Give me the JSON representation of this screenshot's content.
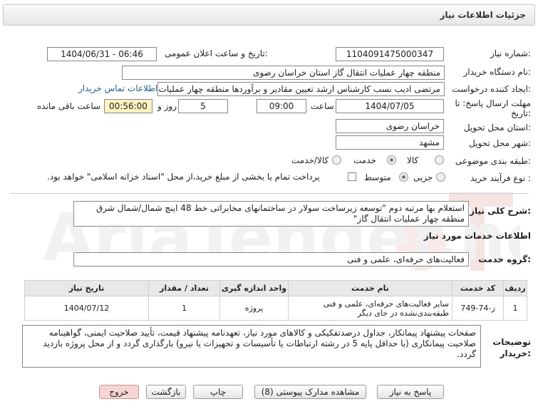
{
  "title": "جزئیات اطلاعات نیاز",
  "labels": {
    "need_number": "شماره نیاز:",
    "announce_datetime": "تاریخ و ساعت اعلان عمومی:",
    "buyer_org": "نام دستگاه خریدار:",
    "requester": "ایجاد کننده درخواست:",
    "deadline_line1": "مهلت ارسال پاسخ: تا",
    "deadline_line2": "تاریخ:",
    "time_word": "ساعت",
    "days_word": "روز و",
    "remaining_word": "ساعت باقی مانده",
    "province": "استان محل تحویل:",
    "city": "شهر محل تحویل:",
    "category": "طبقه بندی موضوعی:",
    "process_type": "نوع فرآیند خرید :",
    "general_desc": "شرح کلی نیاز:",
    "services_info": "اطلاعات خدمات مورد نیاز",
    "service_group": "گروه خدمت:",
    "buyer_notes_1": "توضیحات",
    "buyer_notes_2": "خریدار:"
  },
  "values": {
    "need_number": "1104091475000347",
    "announce_datetime": "1404/06/31 - 06:46",
    "buyer_org": "منطقه چهار عملیات انتقال گاز    استان خراسان رضوی",
    "requester": "مرتضی ادیب نسب کارشناس ارشد تعیین مقادیر و برآوردها منطقه چهار عملیات",
    "contact_link": "اطلاعات تماس خریدار",
    "deadline_date": "1404/07/05",
    "deadline_time": "09:00",
    "days": "5",
    "remaining": "00:56:00",
    "province": "خراسان رضوی",
    "city": "مشهد",
    "category_options": [
      "کالا",
      "خدمت",
      "کالا/خدمت"
    ],
    "category_selected": "خدمت",
    "process_options": [
      "جزیی",
      "متوسط"
    ],
    "process_selected": "متوسط",
    "payment_note": "پرداخت تمام یا بخشی از مبلغ خرید،از محل \"اسناد خزانه اسلامی\" خواهد بود.",
    "general_desc": "استعلام بها مرتبه دوم \"توسعه زیرساخت سولار در ساختمانهای مخابراتی خط 48 اینچ شمال/شمال شرق منطقه چهار عملیات انتقال گاز\"",
    "service_group": "فعالیت‌های حرفه‌ای، علمی و فنی",
    "buyer_notes": "صفحات پیشنهاد پیمانکار، جداول درصدتفکیکی و کالاهای مورد نیاز، تعهدنامه پیشنهاد قیمت، تأیید صلاحیت ایمنی، گواهینامه صلاحیت پیمانکاری (با حداقل پایه 5 در رشته ارتباطات یا تأسیسات و تجهیزات یا نیرو) بارگذاری گردد و از محل پروژه بازدید گردد."
  },
  "table": {
    "headers": [
      "ردیف",
      "کد خدمت",
      "نام خدمت",
      "واحد اندازه گیری",
      "تعداد / مقدار",
      "تاریخ نیاز"
    ],
    "rows": [
      [
        "1",
        "ز-74-749",
        "سایر فعالیت‌های حرفه‌ای، علمی و فنی طبقه‌بندی‌نشده در جای دیگر",
        "پروژه",
        "1",
        "1404/07/12"
      ]
    ]
  },
  "buttons": {
    "reply": "پاسخ به نیاز",
    "view_docs": "مشاهده مدارک پیوستی (8)",
    "print": "چاپ",
    "back": "بازگشت",
    "exit": "خروج"
  },
  "watermark_text": "AriaTender.neT",
  "colors": {
    "link": "#1a5fb4",
    "remaining_bg": "#fff3c0",
    "exit_bg": "#f6d4d4"
  }
}
